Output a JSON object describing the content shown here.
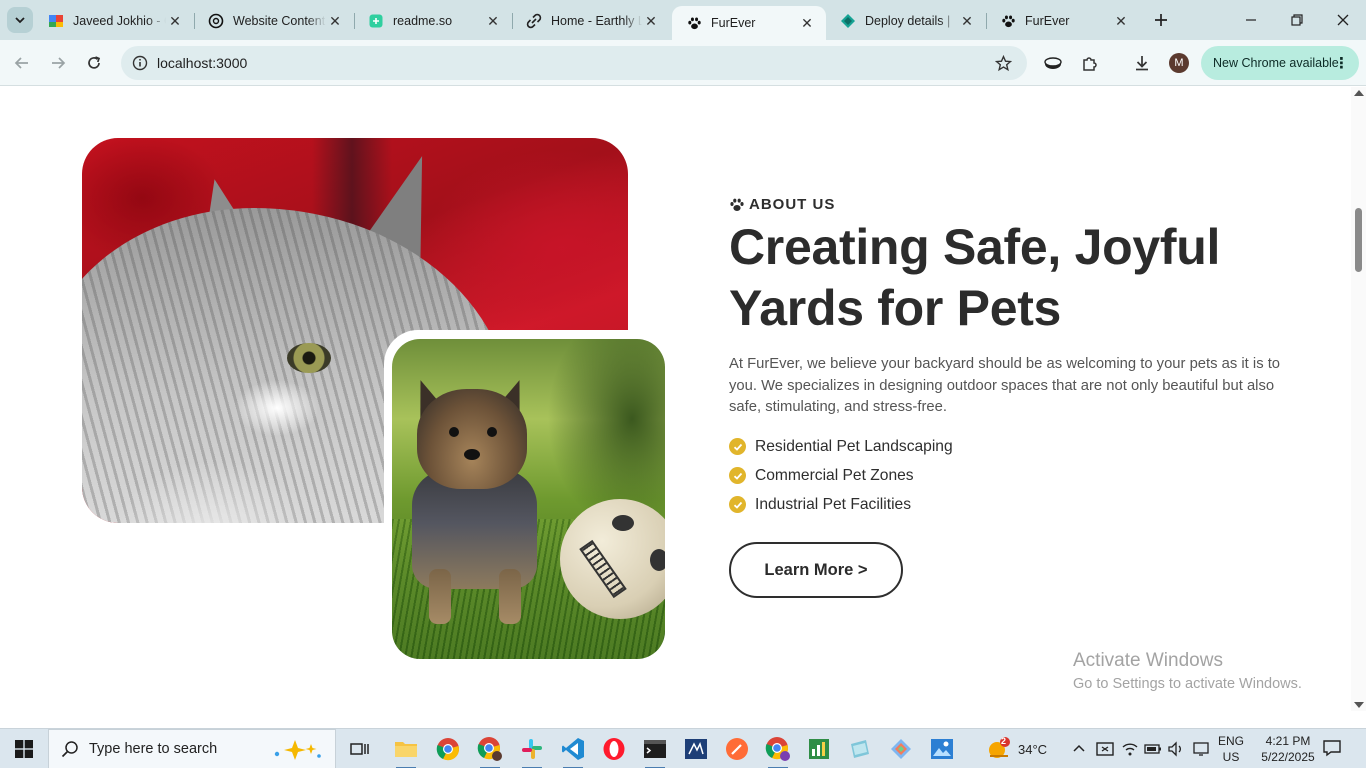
{
  "browser": {
    "tabs": [
      {
        "title": "Javeed Jokhio - G",
        "icon": "google-workspace-icon"
      },
      {
        "title": "Website Content",
        "icon": "openai-icon"
      },
      {
        "title": "readme.so",
        "icon": "readme-icon"
      },
      {
        "title": "Home - Earthly L",
        "icon": "link-icon"
      },
      {
        "title": "FurEver",
        "icon": "paw-icon",
        "active": true
      },
      {
        "title": "Deploy details |",
        "icon": "netlify-icon"
      },
      {
        "title": "FurEver",
        "icon": "paw-icon"
      }
    ],
    "url": "localhost:3000",
    "profile_initial": "M",
    "update_label": "New Chrome available"
  },
  "about": {
    "eyebrow": "ABOUT US",
    "heading": "Creating Safe, Joyful Yards for Pets",
    "description": "At FurEver, we believe your backyard should be as welcoming to your pets as it is to you. We specializes in designing outdoor spaces that are not only beautiful but also safe, stimulating, and stress-free.",
    "features": [
      "Residential Pet Landscaping",
      "Commercial Pet Zones",
      "Industrial Pet Facilities"
    ],
    "button_label": "Learn More >"
  },
  "watermark": {
    "title": "Activate Windows",
    "subtitle": "Go to Settings to activate Windows."
  },
  "taskbar": {
    "search_placeholder": "Type here to search",
    "weather": "34°C",
    "weather_badge": "2",
    "language": "ENG",
    "region": "US",
    "time": "4:21 PM",
    "date": "5/22/2025"
  },
  "colors": {
    "accent_yellow": "#e1b52b",
    "heading": "#2c2c2c",
    "chrome_update": "#b8ecdf",
    "tabstrip": "#d3e3e6"
  }
}
